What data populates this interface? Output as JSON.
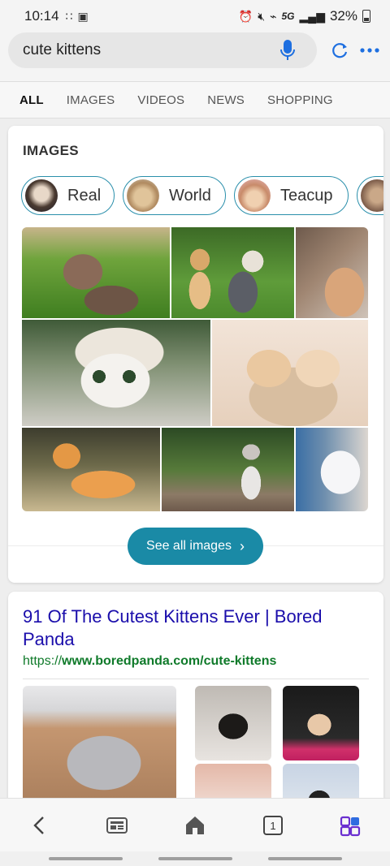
{
  "status_bar": {
    "time": "10:14",
    "battery": "32%",
    "network": "5G"
  },
  "search": {
    "query": "cute kittens"
  },
  "tabs": [
    {
      "label": "ALL",
      "active": true
    },
    {
      "label": "IMAGES",
      "active": false
    },
    {
      "label": "VIDEOS",
      "active": false
    },
    {
      "label": "NEWS",
      "active": false
    },
    {
      "label": "SHOPPING",
      "active": false
    }
  ],
  "images_section": {
    "heading": "IMAGES",
    "chips": [
      {
        "label": "Real"
      },
      {
        "label": "World"
      },
      {
        "label": "Teacup"
      }
    ],
    "see_all_label": "See all images"
  },
  "result": {
    "title": "91 Of The Cutest Kittens Ever | Bored Panda",
    "url_prefix": "https://",
    "url_bold": "www.boredpanda.com/cute-kittens"
  },
  "bottom_nav": {
    "tab_count": "1"
  },
  "colors": {
    "accent": "#1a8aa6",
    "link": "#1a0dab",
    "url": "#0f7a2a"
  }
}
